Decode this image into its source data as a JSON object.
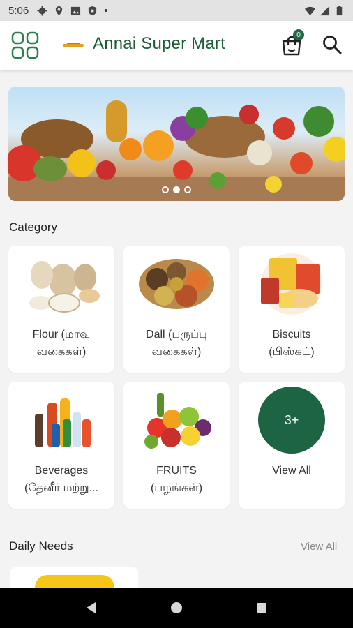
{
  "status_bar": {
    "time": "5:06",
    "dot": "•",
    "left_icons": [
      "gear-icon",
      "location-pin-icon",
      "gallery-icon",
      "shield-icon"
    ],
    "right_icons": [
      "wifi-icon",
      "signal-icon",
      "battery-icon"
    ]
  },
  "app_bar": {
    "title": "Annai Super Mart",
    "cart_count": "0",
    "colors": {
      "brand": "#1b5e36",
      "badge": "#1e6b45"
    }
  },
  "banner": {
    "slides": 3,
    "active_slide": 1
  },
  "category": {
    "title": "Category",
    "items": [
      {
        "line1": "Flour (மாவு",
        "line2": "வகைகள்)",
        "icon": "flour-bags-image"
      },
      {
        "line1": "Dall (பருப்பு",
        "line2": "வகைகள்)",
        "icon": "lentils-image"
      },
      {
        "line1": "Biscuits",
        "line2": "(பிஸ்கட்)",
        "icon": "biscuits-image"
      },
      {
        "line1": "Beverages",
        "line2": "(தேனீர் மற்று...",
        "icon": "beverages-image"
      },
      {
        "line1": "FRUITS",
        "line2": "(பழங்கள்)",
        "icon": "fruits-image"
      },
      {
        "line1": "View All",
        "line2": "",
        "badge": "3+"
      }
    ]
  },
  "daily_needs": {
    "title": "Daily Needs",
    "view_all": "View All"
  },
  "nav": {
    "back": "back-icon",
    "home": "home-icon",
    "recents": "recents-icon"
  }
}
